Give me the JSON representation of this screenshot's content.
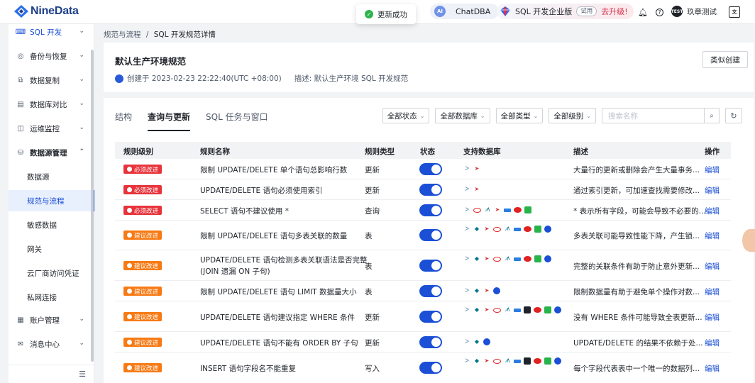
{
  "app": {
    "logo": "NineData"
  },
  "toast": {
    "text": "更新成功"
  },
  "header": {
    "chatdba": "ChatDBA",
    "edition": "SQL 开发企业版",
    "trial": "试用",
    "upgrade": "去升级!",
    "user_initials": "TEST",
    "user_name": "玖章测试",
    "lang_icon": "translate-icon"
  },
  "sidebar": {
    "items": [
      {
        "label": "SQL 开发"
      },
      {
        "label": "备份与恢复"
      },
      {
        "label": "数据复制"
      },
      {
        "label": "数据库对比"
      },
      {
        "label": "运维监控"
      },
      {
        "label": "数据源管理"
      },
      {
        "label": "账户管理"
      },
      {
        "label": "消息中心"
      }
    ],
    "subitems": [
      {
        "label": "数据源"
      },
      {
        "label": "规范与流程"
      },
      {
        "label": "敏感数据"
      },
      {
        "label": "网关"
      },
      {
        "label": "云厂商访问凭证"
      },
      {
        "label": "私网连接"
      }
    ]
  },
  "breadcrumb": {
    "parent": "规范与流程",
    "sep": "/",
    "current": "SQL 开发规范详情"
  },
  "spec": {
    "title": "默认生产环境规范",
    "created": "创建于 2023-02-23 22:22:40(UTC +08:00)",
    "desc": "描述: 默认生产环境 SQL 开发规范",
    "similar_btn": "类似创建"
  },
  "tabs": [
    {
      "label": "结构"
    },
    {
      "label": "查询与更新"
    },
    {
      "label": "SQL 任务与窗口"
    }
  ],
  "filters": {
    "status": "全部状态",
    "database": "全部数据库",
    "type": "全部类型",
    "level": "全部级别",
    "search_placeholder": "搜索名称"
  },
  "table": {
    "headers": [
      "规则级别",
      "规则名称",
      "规则类型",
      "状态",
      "支持数据库",
      "描述",
      "操作"
    ],
    "rows": [
      {
        "level": "必须改进",
        "name": "限制 UPDATE/DELETE 单个语句总影响行数",
        "type": "更新",
        "desc": "大量行的更新或删除会产生大量事务...",
        "action": "编辑"
      },
      {
        "level": "必须改进",
        "name": "UPDATE/DELETE 语句必须使用索引",
        "type": "更新",
        "desc": "通过索引更新，可加速查找需要修改...",
        "action": "编辑"
      },
      {
        "level": "必须改进",
        "name": "SELECT 语句不建议使用 *",
        "type": "查询",
        "desc": "* 表示所有字段，可能会导致不必要的...",
        "action": "编辑"
      },
      {
        "level": "建议改进",
        "name": "限制 UPDATE/DELETE 语句多表关联的数量",
        "type": "表",
        "desc": "多表关联可能导致性能下降，产生锁...",
        "action": "编辑"
      },
      {
        "level": "建议改进",
        "name": "UPDATE/DELETE 语句检测多表关联语法是否完整",
        "name2": "(JOIN 遗漏 ON 子句)",
        "type": "表",
        "desc": "完整的关联条件有助于防止意外更新...",
        "action": "编辑"
      },
      {
        "level": "建议改进",
        "name": "限制 UPDATE/DELETE 语句 LIMIT 数据量大小",
        "type": "表",
        "desc": "限制数据量有助于避免单个操作对数...",
        "action": "编辑"
      },
      {
        "level": "建议改进",
        "name": "UPDATE/DELETE 语句建议指定 WHERE 条件",
        "type": "更新",
        "desc": "没有 WHERE 条件可能导致全表更新...",
        "action": "编辑"
      },
      {
        "level": "建议改进",
        "name": "UPDATE/DELETE 语句不能有 ORDER BY 子句",
        "type": "更新",
        "desc": "UPDATE/DELETE 的结果不依赖于处...",
        "action": "编辑"
      },
      {
        "level": "建议改进",
        "name": "INSERT 语句字段名不能重复",
        "type": "写入",
        "desc": "每个字段代表表中一个唯一的数据列...",
        "action": "编辑"
      }
    ]
  },
  "colors": {
    "primary": "#1a4fd6",
    "must": "#e8333b",
    "suggest": "#f77a14"
  }
}
